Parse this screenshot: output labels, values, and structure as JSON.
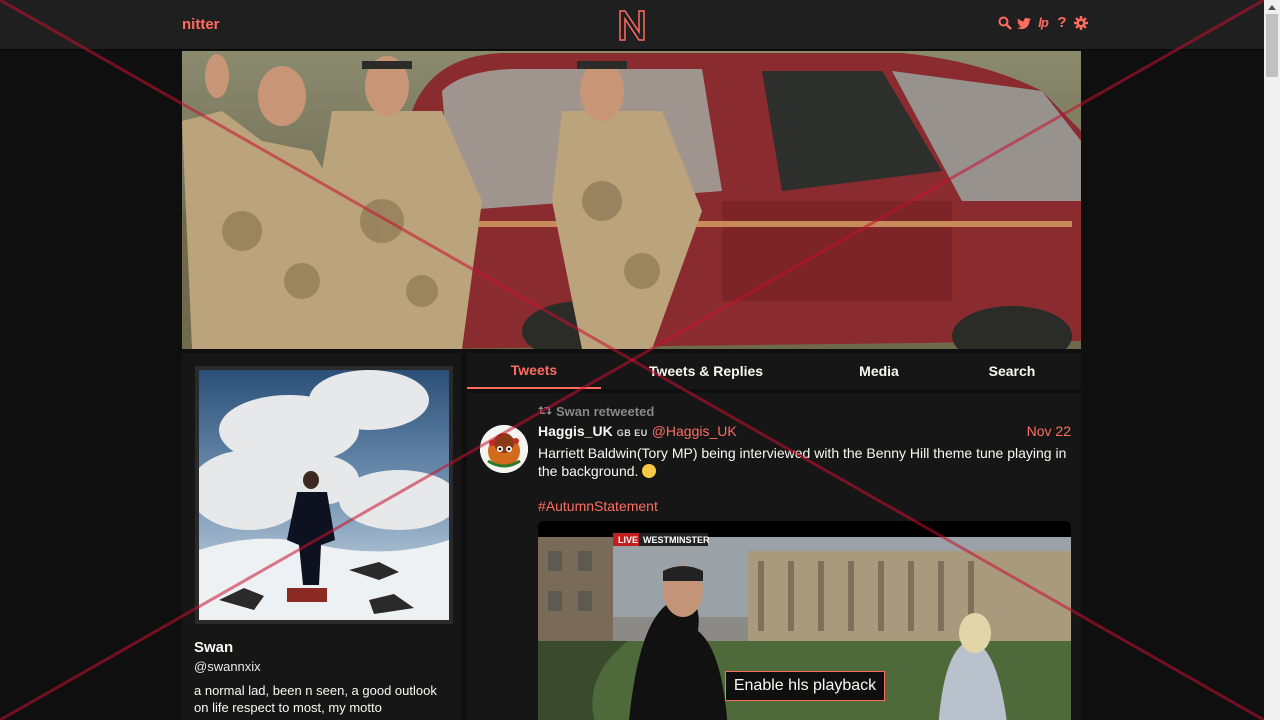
{
  "navbar": {
    "brand": "nitter",
    "logo_letter": "N",
    "icons": [
      "search-icon",
      "twitter-bird-icon",
      "liberapay-icon",
      "help-icon",
      "settings-gear-icon"
    ],
    "liberapay_text": "lp",
    "help_text": "?"
  },
  "profile": {
    "name": "Swan",
    "handle": "@swannxix",
    "bio": "a normal lad, been n seen, a good outlook on life respect to most, my motto"
  },
  "tabs": [
    {
      "label": "Tweets",
      "active": true
    },
    {
      "label": "Tweets & Replies",
      "active": false
    },
    {
      "label": "Media",
      "active": false
    },
    {
      "label": "Search",
      "active": false
    }
  ],
  "tweet": {
    "retweet_label": "Swan retweeted",
    "fullname": "Haggis_UK",
    "flags": "GB EU",
    "username": "@Haggis_UK",
    "date": "Nov 22",
    "text": "Harriett Baldwin(Tory MP) being interviewed with the Benny Hill theme tune playing in the background.",
    "hashtag": "#AutumnStatement",
    "video": {
      "live_label": "LIVE",
      "location_label": "WESTMINSTER",
      "overlay_button": "Enable hls playback"
    }
  },
  "colors": {
    "accent": "#ff6c60",
    "background": "#0f0f0f",
    "panel": "#161616",
    "navbar": "#1f1f1f",
    "text": "#f8f8f2",
    "muted": "#888889"
  }
}
